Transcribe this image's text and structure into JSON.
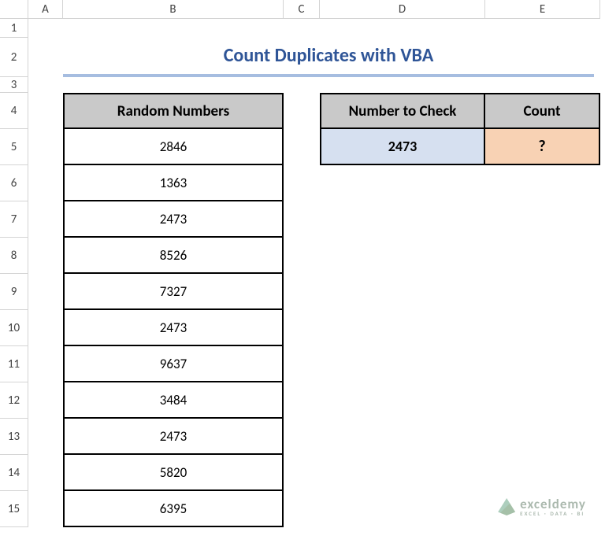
{
  "columns": [
    "A",
    "B",
    "C",
    "D",
    "E"
  ],
  "rows": [
    "1",
    "2",
    "3",
    "4",
    "5",
    "6",
    "7",
    "8",
    "9",
    "10",
    "11",
    "12",
    "13",
    "14",
    "15"
  ],
  "title": "Count Duplicates with VBA",
  "table1": {
    "header": "Random Numbers",
    "values": [
      "2846",
      "1363",
      "2473",
      "8526",
      "7327",
      "2473",
      "9637",
      "3484",
      "2473",
      "5820",
      "6395"
    ]
  },
  "table2": {
    "header_check": "Number to Check",
    "header_count": "Count",
    "value_check": "2473",
    "value_count": "?"
  },
  "watermark": {
    "main": "exceldemy",
    "sub": "EXCEL · DATA · BI"
  }
}
